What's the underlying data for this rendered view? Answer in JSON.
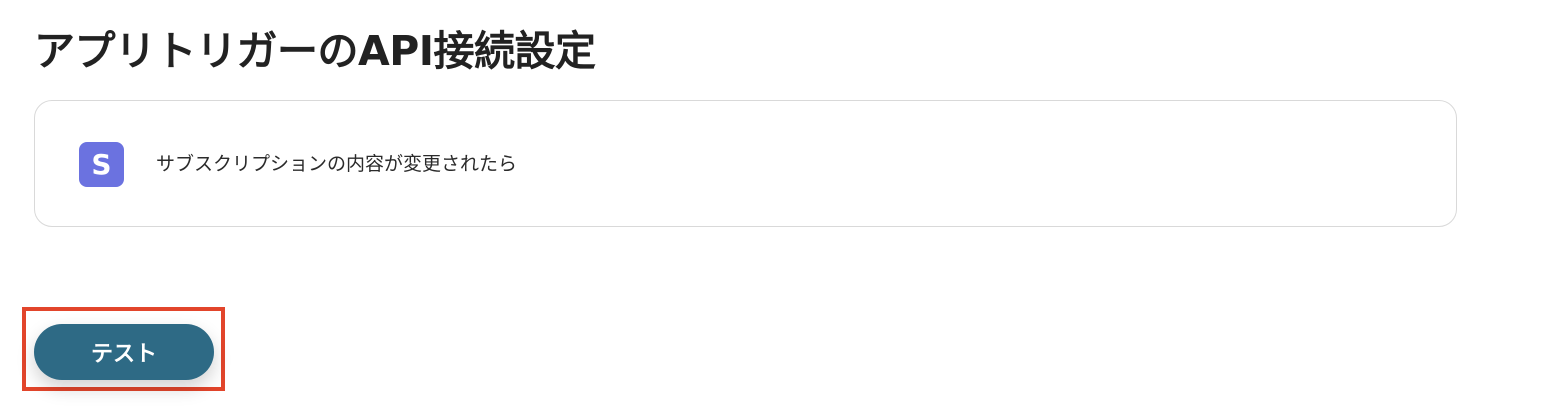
{
  "page": {
    "title": "アプリトリガーのAPI接続設定"
  },
  "trigger": {
    "app_icon_letter": "S",
    "app_icon_name": "stripe-icon",
    "app_icon_color": "#6b72e0",
    "label": "サブスクリプションの内容が変更されたら"
  },
  "actions": {
    "test_label": "テスト",
    "test_button_color": "#2e6a85",
    "highlight_color": "#e2452b"
  }
}
